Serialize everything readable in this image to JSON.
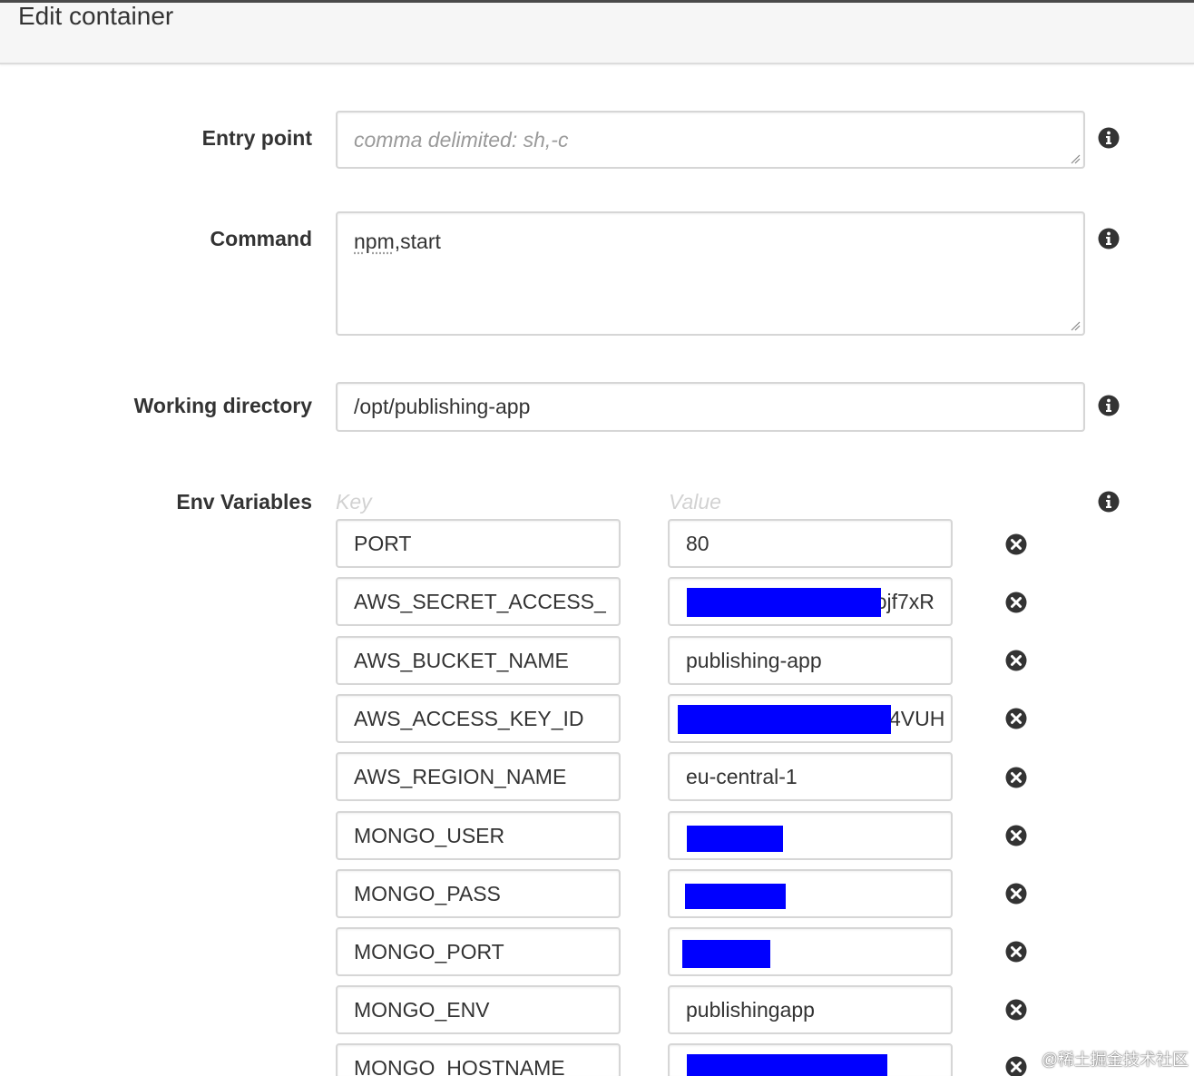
{
  "header": {
    "title": "Edit container"
  },
  "form": {
    "entry_point": {
      "label": "Entry point",
      "value": "",
      "placeholder": "comma delimited: sh,-c"
    },
    "command": {
      "label": "Command",
      "value_word1": "npm",
      "value_rest": ",start"
    },
    "working_directory": {
      "label": "Working directory",
      "value": "/opt/publishing-app"
    }
  },
  "env": {
    "label": "Env Variables",
    "key_header": "Key",
    "value_header": "Value",
    "rows": [
      {
        "key": "PORT",
        "value": "80",
        "redacted": false
      },
      {
        "key": "AWS_SECRET_ACCESS_",
        "value": "ɔjf7xR",
        "redacted": true
      },
      {
        "key": "AWS_BUCKET_NAME",
        "value": "publishing-app",
        "redacted": false
      },
      {
        "key": "AWS_ACCESS_KEY_ID",
        "value": "4VUH",
        "redacted": true
      },
      {
        "key": "AWS_REGION_NAME",
        "value": "eu-central-1",
        "redacted": false
      },
      {
        "key": "MONGO_USER",
        "value": "",
        "redacted": true
      },
      {
        "key": "MONGO_PASS",
        "value": "",
        "redacted": true
      },
      {
        "key": "MONGO_PORT",
        "value": "",
        "redacted": true
      },
      {
        "key": "MONGO_ENV",
        "value": "publishingapp",
        "redacted": false
      },
      {
        "key": "MONGO_HOSTNAME",
        "value": "",
        "redacted": true
      }
    ]
  },
  "icons": {
    "info": "info-icon",
    "remove": "remove-circle-icon",
    "resize": "resize-grip-icon"
  },
  "colors": {
    "redaction": "#0000ff",
    "icon": "#333333",
    "border": "#d6d6d6",
    "header_bg": "#f6f6f6"
  },
  "watermark": "@稀土掘金技术社区"
}
